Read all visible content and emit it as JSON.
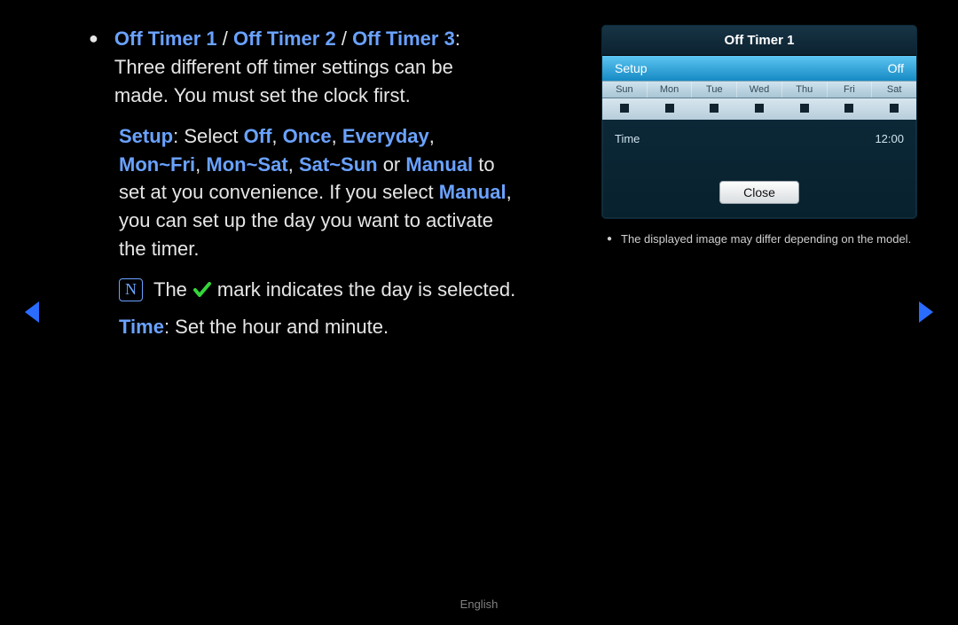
{
  "main": {
    "heading": {
      "t1": "Off Timer 1",
      "sep": " / ",
      "t2": "Off Timer 2",
      "t3": "Off Timer 3"
    },
    "intro_l1": "Three different off timer settings can be",
    "intro_l2": "made. You must set the clock first.",
    "setup": {
      "label": "Setup",
      "colon": ": ",
      "select": "Select ",
      "off": "Off",
      "comma": ", ",
      "once": "Once",
      "everyday": "Everyday",
      "monfri": "Mon~Fri",
      "monsat": "Mon~Sat",
      "satsun": "Sat~Sun",
      "or": " or ",
      "manual": "Manual",
      "to": " to",
      "line3a": "set at you convenience. If you select ",
      "manual2": "Manual",
      "line3b": ",",
      "line4": "you can set up the day you want to activate",
      "line5": "the timer."
    },
    "note_pre": "The ",
    "note_post": " mark indicates the day is selected.",
    "time_label": "Time",
    "time_desc": ": Set the hour and minute."
  },
  "dialog": {
    "title": "Off Timer 1",
    "setup_label": "Setup",
    "setup_value": "Off",
    "days": [
      "Sun",
      "Mon",
      "Tue",
      "Wed",
      "Thu",
      "Fri",
      "Sat"
    ],
    "time_label": "Time",
    "time_value": "12:00",
    "close": "Close"
  },
  "disclaimer": "The displayed image may differ depending on the model.",
  "footer": "English"
}
